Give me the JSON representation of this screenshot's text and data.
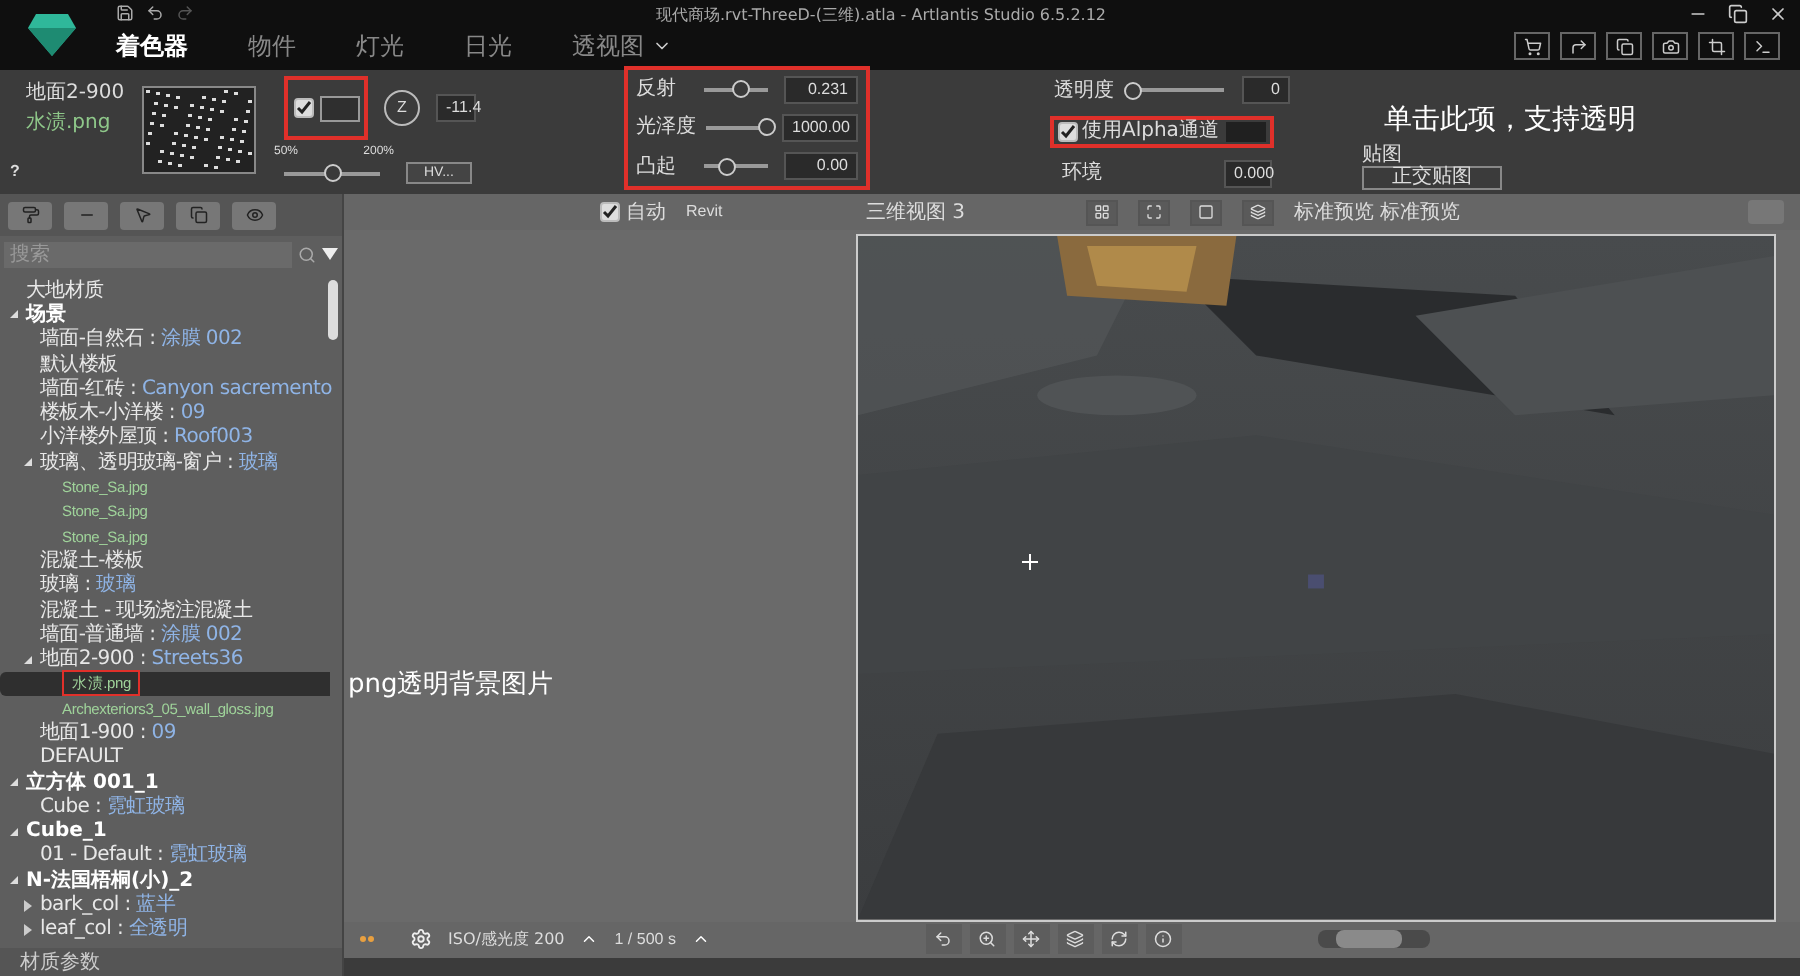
{
  "app": {
    "title": "现代商场.rvt-ThreeD-(三维).atla - Artlantis Studio 6.5.2.12"
  },
  "tabs": [
    {
      "label": "着色器",
      "selected": true
    },
    {
      "label": "物件",
      "selected": false
    },
    {
      "label": "灯光",
      "selected": false
    },
    {
      "label": "日光",
      "selected": false
    },
    {
      "label": "透视图",
      "selected": false
    }
  ],
  "shader": {
    "object": "地面2-900",
    "file": "水渍.png",
    "help": "?",
    "color_enabled": {
      "checked": true
    },
    "dial": "Z",
    "angle": "-11.4",
    "scale_min": "50%",
    "scale_max": "200%",
    "scale": {
      "level": 0.5
    },
    "hv_button": "HV..."
  },
  "params": [
    {
      "label": "反射",
      "level": 0.58,
      "value": "0.231"
    },
    {
      "label": "光泽度",
      "level": 1,
      "value": "1000.00"
    },
    {
      "label": "凸起",
      "level": 0.35,
      "value": "0.00"
    }
  ],
  "transparency": {
    "label": "透明度",
    "level": 0,
    "value": "0"
  },
  "alpha": {
    "label": "使用Alpha通道",
    "checked": true
  },
  "environment": {
    "label": "环境",
    "value": "0.000"
  },
  "mapping": {
    "label": "贴图",
    "value": "正交贴图"
  },
  "annotations": [
    "单击此项，支持透明",
    "png透明背景图片"
  ],
  "search": {
    "placeholder": "搜索"
  },
  "tree": [
    {
      "label": "大地材质",
      "kind": "item",
      "selected": false
    },
    {
      "label": "场景",
      "kind": "group",
      "expanded": true,
      "selected": false,
      "children": [
        {
          "label": "墙面-自然石 : ",
          "material": "涂膜 002",
          "kind": "item",
          "selected": false
        },
        {
          "label": "默认楼板",
          "kind": "item",
          "selected": false
        },
        {
          "label": "墙面-红砖 : ",
          "material": "Canyon sacremento",
          "kind": "item",
          "selected": false
        },
        {
          "label": "楼板木-小洋楼 : ",
          "material": "09",
          "kind": "item",
          "selected": false
        },
        {
          "label": "小洋楼外屋顶 : ",
          "material": "Roof003",
          "kind": "item",
          "selected": false
        },
        {
          "label": "玻璃、透明玻璃-窗户 : ",
          "material": "玻璃",
          "kind": "item",
          "expanded": true,
          "selected": false,
          "children": [
            {
              "label": "Stone_Sa.jpg",
              "kind": "file",
              "selected": false
            },
            {
              "label": "Stone_Sa.jpg",
              "kind": "file",
              "selected": false
            },
            {
              "label": "Stone_Sa.jpg",
              "kind": "file",
              "selected": false
            }
          ]
        },
        {
          "label": "混凝土-楼板",
          "kind": "item",
          "selected": false
        },
        {
          "label": "玻璃 : ",
          "material": "玻璃",
          "kind": "item",
          "selected": false
        },
        {
          "label": "混凝土 - 现场浇注混凝土",
          "kind": "item",
          "selected": false
        },
        {
          "label": "墙面-普通墙 : ",
          "material": "涂膜 002",
          "kind": "item",
          "selected": false
        },
        {
          "label": "地面2-900 : ",
          "material": "Streets36",
          "kind": "item",
          "expanded": true,
          "selected": false,
          "children": [
            {
              "label": "水渍.png",
              "kind": "file",
              "selected": true
            },
            {
              "label": "Archexteriors3_05_wall_gloss.jpg",
              "kind": "file",
              "selected": false
            }
          ]
        },
        {
          "label": "地面1-900 : ",
          "material": "09",
          "kind": "item",
          "selected": false
        },
        {
          "label": "DEFAULT",
          "kind": "item",
          "selected": false
        }
      ]
    },
    {
      "label": "立方体 001_1",
      "kind": "group",
      "expanded": true,
      "selected": false,
      "children": [
        {
          "label": "Cube : ",
          "material": "霓虹玻璃",
          "kind": "item",
          "selected": false
        }
      ]
    },
    {
      "label": "Cube_1",
      "kind": "group",
      "expanded": true,
      "selected": false,
      "children": [
        {
          "label": "01 - Default : ",
          "material": "霓虹玻璃",
          "kind": "item",
          "selected": false
        }
      ]
    },
    {
      "label": "N-法国梧桐(小)_2",
      "kind": "group",
      "expanded": true,
      "selected": false,
      "children": [
        {
          "label": "bark_col : ",
          "material": "蓝半",
          "kind": "item",
          "expanded": false,
          "selected": false
        },
        {
          "label": "leaf_col : ",
          "material": "全透明",
          "kind": "item",
          "expanded": false,
          "selected": false
        }
      ]
    }
  ],
  "footer": "材质参数",
  "view_bar": {
    "auto": {
      "label": "自动",
      "checked": true
    },
    "source": "Revit",
    "view": "三维视图 3",
    "preview": "标准预览 标准预览"
  },
  "camera": {
    "iso": "ISO/感光度 200",
    "shutter": "1 / 500 s",
    "zoom": {
      "level": 0.4
    }
  }
}
